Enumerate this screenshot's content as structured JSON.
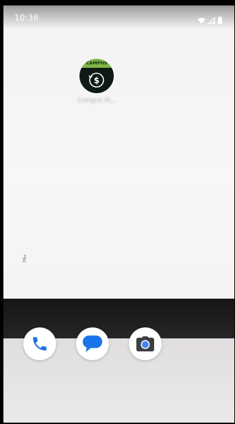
{
  "status_bar": {
    "time": "10:36",
    "icons": [
      "wifi-icon",
      "signal-icon",
      "battery-icon"
    ]
  },
  "home": {
    "apps": [
      {
        "label": "Campus M...",
        "icon": "campus-money-icon",
        "badge_text": "CAMPUS"
      }
    ]
  },
  "dock": {
    "apps": [
      {
        "icon": "phone-icon"
      },
      {
        "icon": "messages-icon"
      },
      {
        "icon": "camera-icon"
      }
    ]
  },
  "colors": {
    "campus_band": "#7fb844",
    "campus_body": "#0f1a17",
    "phone_blue": "#1a73e8",
    "messages_blue": "#1a73e8",
    "camera_dark": "#3c4043"
  }
}
